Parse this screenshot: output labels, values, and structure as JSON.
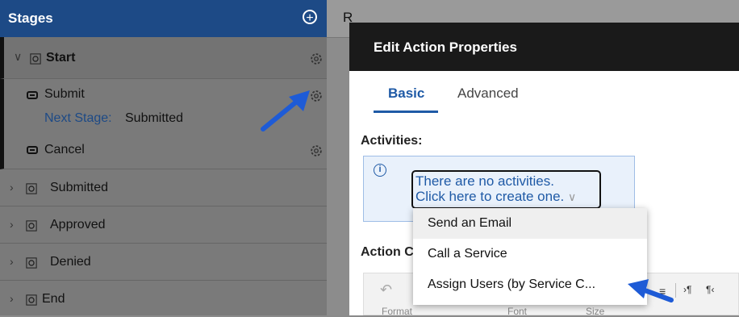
{
  "stages": {
    "title": "Stages",
    "items": [
      {
        "label": "Start",
        "expanded": true,
        "actions": [
          {
            "label": "Submit",
            "next_label": "Next Stage:",
            "next_value": "Submitted"
          },
          {
            "label": "Cancel"
          }
        ]
      },
      {
        "label": "Submitted"
      },
      {
        "label": "Approved"
      },
      {
        "label": "Denied"
      },
      {
        "label": "End"
      }
    ]
  },
  "background_tab_letter": "R",
  "modal": {
    "title": "Edit Action Properties",
    "tabs": [
      {
        "label": "Basic",
        "active": true
      },
      {
        "label": "Advanced",
        "active": false
      }
    ],
    "activities_label": "Activities:",
    "info_text_line1": "There are no activities.",
    "info_text_line2": "Click here to create one.",
    "dropdown": [
      "Send an Email",
      "Call a Service",
      "Assign Users (by Service C..."
    ],
    "action_label": "Action C",
    "toolbar_partial": [
      "Format",
      "Font",
      "Size"
    ]
  },
  "colors": {
    "header_blue": "#1d4a86",
    "link_blue": "#1f5aa6",
    "annotation_arrow": "#1e5bd6"
  }
}
